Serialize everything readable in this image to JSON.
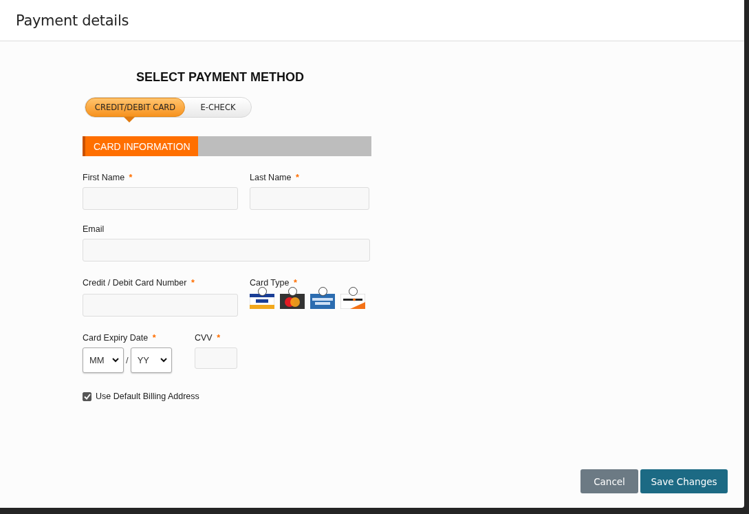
{
  "dialog": {
    "title": "Payment details"
  },
  "heading": "SELECT PAYMENT METHOD",
  "methods": [
    {
      "label": "CREDIT/DEBIT CARD",
      "selected": true
    },
    {
      "label": "E-CHECK",
      "selected": false
    }
  ],
  "section": {
    "title": "CARD INFORMATION"
  },
  "fields": {
    "first_name": {
      "label": "First Name",
      "required_mark": "*"
    },
    "last_name": {
      "label": "Last Name",
      "required_mark": "*"
    },
    "email": {
      "label": "Email"
    },
    "card_number": {
      "label": "Credit / Debit Card Number",
      "required_mark": "*"
    },
    "card_type": {
      "label": "Card Type",
      "required_mark": "*",
      "options": [
        {
          "kind": "visa",
          "selected": false
        },
        {
          "kind": "mastercard",
          "selected": false
        },
        {
          "kind": "amex",
          "selected": false
        },
        {
          "kind": "discover",
          "selected": false
        }
      ]
    },
    "expiry": {
      "label": "Card Expiry Date",
      "required_mark": "*",
      "month": "MM",
      "separator": "/",
      "year": "YY"
    },
    "cvv": {
      "label": "CVV",
      "required_mark": "*"
    }
  },
  "billing": {
    "label": "Use Default Billing Address",
    "checked": true
  },
  "buttons": [
    {
      "label": "Cancel",
      "kind": "secondary"
    },
    {
      "label": "Save Changes",
      "kind": "primary"
    }
  ]
}
